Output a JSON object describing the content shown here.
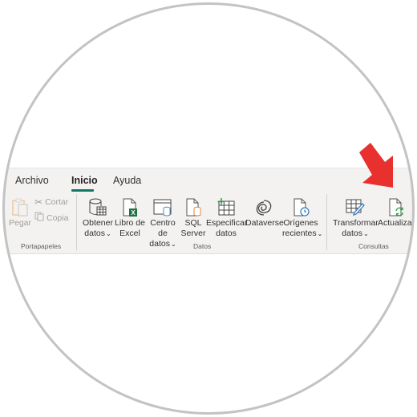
{
  "tabs": [
    {
      "label": "Archivo",
      "active": false
    },
    {
      "label": "Inicio",
      "active": true
    },
    {
      "label": "Ayuda",
      "active": false
    }
  ],
  "groups": {
    "portapapeles": {
      "label": "Portapapeles",
      "paste": "Pegar",
      "cut": "Cortar",
      "copy": "Copia"
    },
    "datos": {
      "label": "Datos",
      "buttons": [
        {
          "line1": "Obtener",
          "line2": "datos",
          "dropdown": true,
          "icon": "database-table-icon"
        },
        {
          "line1": "Libro de",
          "line2": "Excel",
          "dropdown": false,
          "icon": "excel-file-icon"
        },
        {
          "line1": "Centro de",
          "line2": "datos",
          "dropdown": true,
          "icon": "datahub-icon"
        },
        {
          "line1": "SQL",
          "line2": "Server",
          "dropdown": false,
          "icon": "sql-server-icon"
        },
        {
          "line1": "Especificar",
          "line2": "datos",
          "dropdown": false,
          "icon": "enter-data-icon"
        },
        {
          "line1": "Dataverse",
          "line2": "",
          "dropdown": false,
          "icon": "dataverse-icon"
        },
        {
          "line1": "Orígenes",
          "line2": "recientes",
          "dropdown": true,
          "icon": "recent-sources-icon"
        }
      ]
    },
    "consultas": {
      "label": "Consultas",
      "buttons": [
        {
          "line1": "Transformar",
          "line2": "datos",
          "dropdown": true,
          "icon": "transform-data-icon"
        },
        {
          "line1": "Actualizar",
          "line2": "",
          "dropdown": false,
          "icon": "refresh-icon"
        }
      ]
    }
  },
  "chevron": "⌄",
  "colors": {
    "accent": "#117865",
    "arrow": "#e8302f",
    "excel_green": "#1e7145",
    "ring": "#c3c3c3"
  }
}
